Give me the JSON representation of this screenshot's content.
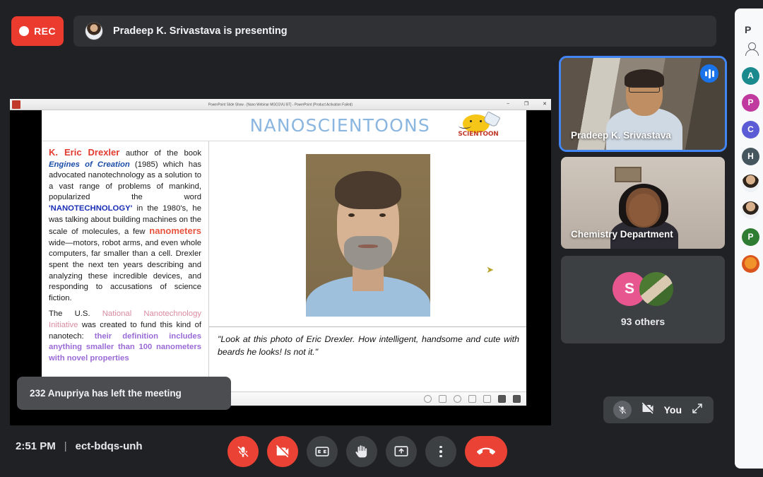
{
  "topbar": {
    "rec_label": "REC",
    "presenting_text": "Pradeep K. Srivastava is presenting"
  },
  "presentation": {
    "window_title": "PowerPoint Slide Show - [Nano Webinar MGCGVU BT] - PowerPoint (Product Activation Failed)",
    "slide_title": "NANOSCIENTOONS",
    "logo_word": "SCIENTOON",
    "paragraph1": {
      "name": "K. Eric Drexler",
      "mid1": " author of the book ",
      "book": "Engines of Creation",
      "mid2": " (1985) which has advocated nanotechnology as a solution to a vast range of problems of mankind, popularized the word ",
      "word": "'NANOTECHNOLOGY'",
      "mid3": " in the 1980's, he was talking about building machines on the scale of molecules, a few ",
      "highlight": "nanometers",
      "tail": " wide—motors, robot arms, and even whole computers, far smaller than a cell. Drexler spent the next ten years describing and analyzing these incredible devices, and responding to accusations of science fiction."
    },
    "paragraph2": {
      "lead": "The U.S. ",
      "initiative": "National Nanotechnology Initiative",
      "mid": " was created to fund this kind of nanotech: ",
      "definition": "their definition includes anything smaller than 100 nanometers with novel properties"
    },
    "caption": "\"Look at this photo of Eric Drexler. How intelligent, handsome and cute with beards he looks!  Is not it.\"",
    "window_buttons": {
      "minimize": "−",
      "restore": "❐",
      "close": "✕"
    }
  },
  "toast": {
    "message": "232 Anupriya has left the meeting"
  },
  "tiles": [
    {
      "name": "Pradeep K. Srivastava",
      "active": true,
      "speaking": true
    },
    {
      "name": "Chemistry Department",
      "active": false,
      "speaking": false
    }
  ],
  "others": {
    "label": "93 others",
    "avatar_initial": "S",
    "avatar_color": "#e8568f"
  },
  "selfview": {
    "label": "You"
  },
  "bottombar": {
    "time": "2:51 PM",
    "separator": "|",
    "meeting_code": "ect-bdqs-unh",
    "controls": [
      {
        "name": "microphone-off-button",
        "style": "red"
      },
      {
        "name": "camera-off-button",
        "style": "red"
      },
      {
        "name": "captions-button",
        "style": "grey"
      },
      {
        "name": "raise-hand-button",
        "style": "grey"
      },
      {
        "name": "present-screen-button",
        "style": "grey"
      },
      {
        "name": "more-options-button",
        "style": "grey"
      },
      {
        "name": "end-call-button",
        "style": "end"
      }
    ]
  },
  "panel": {
    "title": "P",
    "participants": [
      {
        "initial": "A",
        "color": "#1b8a8f"
      },
      {
        "initial": "P",
        "color": "#c0399f"
      },
      {
        "initial": "C",
        "color": "#5b5bd6"
      },
      {
        "initial": "H",
        "color": "#46565e"
      },
      {
        "initial": "",
        "color": "photo"
      },
      {
        "initial": "",
        "color": "photo"
      },
      {
        "initial": "P",
        "color": "#2e7d32"
      },
      {
        "initial": "",
        "color": "#d9541e"
      }
    ]
  },
  "colors": {
    "accent_blue": "#4285f4",
    "record_red": "#ea3b2e",
    "end_call_red": "#ea4335",
    "app_background": "#202124",
    "tile_background": "#3c4043",
    "panel_background": "#f8f9fa"
  }
}
